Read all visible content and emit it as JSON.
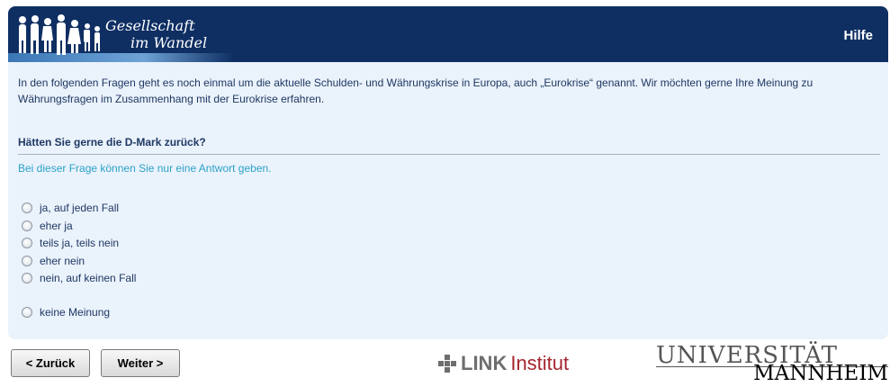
{
  "header": {
    "logo_line1": "Gesellschaft",
    "logo_line2": "im Wandel",
    "help_label": "Hilfe"
  },
  "intro_text": "In den folgenden Fragen geht es noch einmal um die aktuelle Schulden- und Währungskrise in Europa, auch „Eurokrise“ genannt. Wir möchten gerne Ihre Meinung zu Währungsfragen im Zusammenhang mit der Eurokrise erfahren.",
  "question": {
    "title": "Hätten Sie gerne die D-Mark zurück?",
    "hint": "Bei dieser Frage können Sie nur eine Antwort geben.",
    "options": [
      "ja, auf jeden Fall",
      "eher ja",
      "teils ja, teils nein",
      "eher nein",
      "nein, auf keinen Fall",
      "keine Meinung"
    ]
  },
  "nav": {
    "back_label": "< Zurück",
    "next_label": "Weiter >"
  },
  "footer": {
    "link_word": "LINK",
    "link_institut": "Institut",
    "uni_top": "UNIVERSITÄT",
    "uni_bottom": "MANNHEIM"
  },
  "colors": {
    "header_bg": "#0f2f63",
    "panel_bg": "#eaf2fb",
    "hint_text": "#2da2c9",
    "link_red": "#a6262e"
  },
  "icons": [
    "people-silhouette-icon",
    "radio-unchecked-icon",
    "link-cross-icon"
  ]
}
